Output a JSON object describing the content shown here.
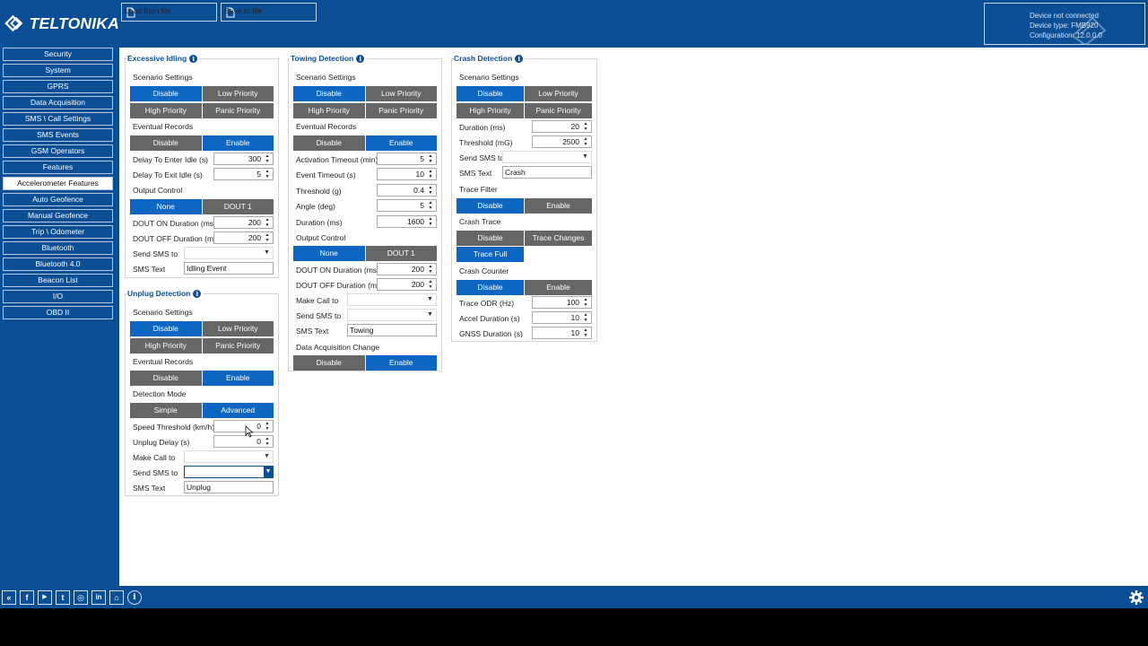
{
  "header": {
    "brand": "TELTONIKA",
    "load_label": "Load from file",
    "save_label": "Save to file",
    "device_status": "Device not connected",
    "device_type": "Device type: FMB920",
    "configuration": "Configuration: 12.0.0.0"
  },
  "sidebar": {
    "items": [
      {
        "label": "Security"
      },
      {
        "label": "System"
      },
      {
        "label": "GPRS"
      },
      {
        "label": "Data Acquisition"
      },
      {
        "label": "SMS \\ Call Settings"
      },
      {
        "label": "SMS Events"
      },
      {
        "label": "GSM Operators"
      },
      {
        "label": "Features"
      },
      {
        "label": "Accelerometer Features"
      },
      {
        "label": "Auto Geofence"
      },
      {
        "label": "Manual Geofence"
      },
      {
        "label": "Trip \\ Odometer"
      },
      {
        "label": "Bluetooth"
      },
      {
        "label": "Bluetooth 4.0"
      },
      {
        "label": "Beacon List"
      },
      {
        "label": "I/O"
      },
      {
        "label": "OBD II"
      }
    ],
    "active": "Accelerometer Features"
  },
  "idling": {
    "title": "Excessive Idling",
    "scenario_label": "Scenario Settings",
    "scenario": [
      "Disable",
      "Low Priority",
      "High Priority",
      "Panic Priority"
    ],
    "eventual_label": "Eventual Records",
    "eventual": [
      "Disable",
      "Enable"
    ],
    "enter_idle_label": "Delay To Enter Idle (s)",
    "enter_idle": "300",
    "exit_idle_label": "Delay To Exit Idle (s)",
    "exit_idle": "5",
    "output_label": "Output Control",
    "output": [
      "None",
      "DOUT 1"
    ],
    "on_label": "DOUT ON Duration (ms)",
    "on_value": "200",
    "off_label": "DOUT OFF Duration (ms)",
    "off_value": "200",
    "send_sms_label": "Send SMS to",
    "sms_text_label": "SMS Text",
    "sms_text": "Idling Event"
  },
  "unplug": {
    "title": "Unplug Detection",
    "scenario_label": "Scenario Settings",
    "scenario": [
      "Disable",
      "Low Priority",
      "High Priority",
      "Panic Priority"
    ],
    "eventual_label": "Eventual Records",
    "eventual": [
      "Disable",
      "Enable"
    ],
    "mode_label": "Detection Mode",
    "mode": [
      "Simple",
      "Advanced"
    ],
    "speed_label": "Speed Threshold (km/h)",
    "speed": "0",
    "delay_label": "Unplug Delay (s)",
    "delay": "0",
    "call_label": "Make Call to",
    "send_sms_label": "Send SMS to",
    "sms_text_label": "SMS Text",
    "sms_text": "Unplug"
  },
  "towing": {
    "title": "Towing Detection",
    "scenario_label": "Scenario Settings",
    "scenario": [
      "Disable",
      "Low Priority",
      "High Priority",
      "Panic Priority"
    ],
    "eventual_label": "Eventual Records",
    "eventual": [
      "Disable",
      "Enable"
    ],
    "activation_label": "Activation Timeout (min)",
    "activation": "5",
    "event_label": "Event Timeout (s)",
    "event": "10",
    "threshold_label": "Threshold (g)",
    "threshold": "0.4",
    "angle_label": "Angle (deg)",
    "angle": "5",
    "duration_label": "Duration (ms)",
    "duration": "1600",
    "output_label": "Output Control",
    "output": [
      "None",
      "DOUT 1"
    ],
    "on_label": "DOUT ON Duration (ms)",
    "on_value": "200",
    "off_label": "DOUT OFF Duration (ms)",
    "off_value": "200",
    "call_label": "Make Call to",
    "send_sms_label": "Send SMS to",
    "sms_text_label": "SMS Text",
    "sms_text": "Towing",
    "dac_label": "Data Acquisition Change",
    "dac": [
      "Disable",
      "Enable"
    ]
  },
  "crash": {
    "title": "Crash Detection",
    "scenario_label": "Scenario Settings",
    "scenario": [
      "Disable",
      "Low Priority",
      "High Priority",
      "Panic Priority"
    ],
    "duration_label": "Duration (ms)",
    "duration": "20",
    "threshold_label": "Threshold (mG)",
    "threshold": "2500",
    "send_sms_label": "Send SMS to",
    "sms_text_label": "SMS Text",
    "sms_text": "Crash",
    "filter_label": "Trace Filter",
    "filter": [
      "Disable",
      "Enable"
    ],
    "trace_label": "Crash Trace",
    "trace": [
      "Disable",
      "Trace Changes",
      "Trace Full"
    ],
    "counter_label": "Crash Counter",
    "counter": [
      "Disable",
      "Enable"
    ],
    "odr_label": "Trace ODR (Hz)",
    "odr": "100",
    "accel_label": "Accel Duration (s)",
    "accel": "10",
    "gnss_label": "GNSS Duration (s)",
    "gnss": "10"
  },
  "footer": {
    "icons": [
      "teltonika-icon",
      "facebook-icon",
      "youtube-icon",
      "twitter-icon",
      "instagram-icon",
      "linkedin-icon",
      "car-icon",
      "info-icon"
    ],
    "icon_glyphs": [
      "«",
      "f",
      "▶",
      "t",
      "◎",
      "in",
      "⌂",
      "i"
    ]
  },
  "colors": {
    "brand": "#0a4e96",
    "selected": "#0c66c2",
    "unselected": "#666666"
  }
}
